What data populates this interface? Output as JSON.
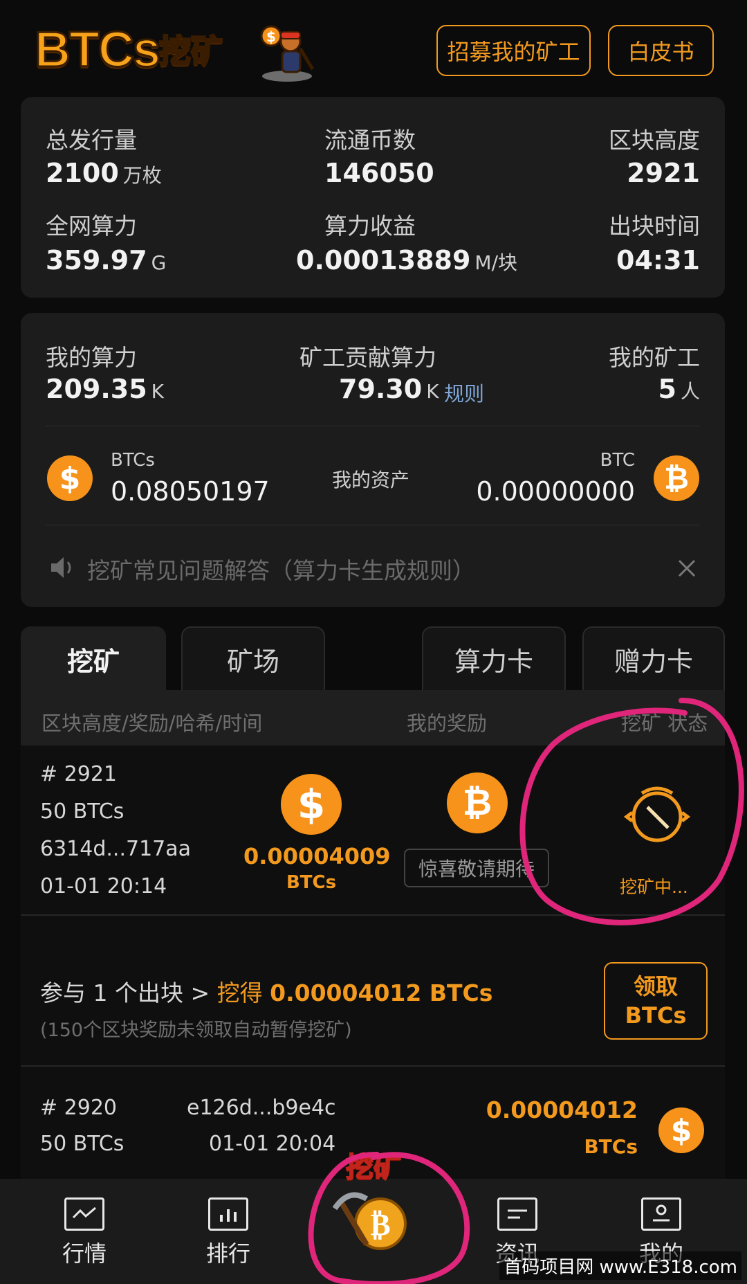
{
  "header": {
    "logo_text": "BTCs",
    "logo_cn": "挖矿",
    "recruit_button": "招募我的矿工",
    "whitepaper_button": "白皮书"
  },
  "stats": {
    "total_supply": {
      "label": "总发行量",
      "value": "2100",
      "unit": "万枚"
    },
    "circulation": {
      "label": "流通币数",
      "value": "146050"
    },
    "block_height": {
      "label": "区块高度",
      "value": "2921"
    },
    "network_hash": {
      "label": "全网算力",
      "value": "359.97",
      "unit": "G"
    },
    "hash_reward": {
      "label": "算力收益",
      "value": "0.00013889",
      "unit": "M/块"
    },
    "block_time": {
      "label": "出块时间",
      "value": "04:31"
    }
  },
  "mine": {
    "my_hash": {
      "label": "我的算力",
      "value": "209.35",
      "unit": "K"
    },
    "miner_hash": {
      "label": "矿工贡献算力",
      "value": "79.30",
      "unit": "K",
      "rules_link": "规则"
    },
    "my_miners": {
      "label": "我的矿工",
      "value": "5",
      "unit": "人"
    },
    "asset_btcs": {
      "name": "BTCs",
      "value": "0.08050197"
    },
    "asset_label": "我的资产",
    "asset_btc": {
      "name": "BTC",
      "value": "0.00000000"
    },
    "notice": "挖矿常见问题解答（算力卡生成规则）"
  },
  "tabs": [
    "挖矿",
    "矿场",
    "算力卡",
    "赠力卡"
  ],
  "columns": {
    "block": "区块高度/奖励/哈希/时间",
    "reward": "我的奖励",
    "status": "挖矿 状态"
  },
  "current_row": {
    "height": "# 2921",
    "reward": "50 BTCs",
    "hash": "6314d...717aa",
    "time": "01-01 20:14",
    "my_reward": "0.00004009",
    "my_reward_unit": "BTCs",
    "btc_pending": "惊喜敬请期待",
    "status": "挖矿中..."
  },
  "claim": {
    "prefix": "参与",
    "count": "1",
    "middle": "个出块 >",
    "mined_label": "挖得",
    "amount": "0.00004012 BTCs",
    "note": "(150个区块奖励未领取自动暂停挖矿)",
    "button_line1": "领取",
    "button_line2": "BTCs"
  },
  "history_row": {
    "height": "# 2920",
    "hash": "e126d...b9e4c",
    "reward": "50 BTCs",
    "time": "01-01 20:04",
    "amount": "0.00004012",
    "unit": "BTCs"
  },
  "nav": {
    "market": "行情",
    "ranking": "排行",
    "mining": "挖矿",
    "news": "资讯",
    "mine": "我的"
  },
  "watermark": "首码项目网 www.E318.com",
  "colors": {
    "accent": "#f39a1e",
    "coin": "#f7931a",
    "annotation": "#e0267a"
  }
}
